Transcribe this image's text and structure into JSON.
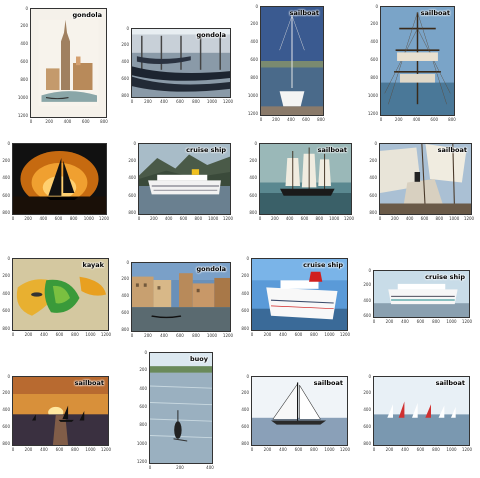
{
  "panels": [
    {
      "label": "gondola",
      "scene": "watercolor",
      "yticks": [
        "0",
        "200",
        "400",
        "600",
        "800",
        "1000",
        "1200"
      ],
      "xticks": [
        "0",
        "200",
        "400",
        "600",
        "800"
      ]
    },
    {
      "label": "gondola",
      "scene": "gondolas",
      "yticks": [
        "0",
        "200",
        "400",
        "600",
        "800"
      ],
      "xticks": [
        "0",
        "200",
        "400",
        "600",
        "800",
        "1000",
        "1200"
      ]
    },
    {
      "label": "sailboat",
      "scene": "sailboat-dock",
      "yticks": [
        "0",
        "200",
        "400",
        "600",
        "800",
        "1000",
        "1200"
      ],
      "xticks": [
        "0",
        "200",
        "400",
        "600",
        "800"
      ]
    },
    {
      "label": "sailboat",
      "scene": "tallship-mast",
      "yticks": [
        "0",
        "200",
        "400",
        "600",
        "800",
        "1000",
        "1200"
      ],
      "xticks": [
        "0",
        "200",
        "400",
        "600",
        "800"
      ]
    },
    {
      "label": "",
      "scene": "sunset-sail",
      "yticks": [
        "0",
        "200",
        "400",
        "600",
        "800"
      ],
      "xticks": [
        "0",
        "200",
        "400",
        "600",
        "800",
        "1000",
        "1200"
      ]
    },
    {
      "label": "cruise ship",
      "scene": "cruise-fjord",
      "yticks": [
        "0",
        "200",
        "400",
        "600",
        "800"
      ],
      "xticks": [
        "0",
        "200",
        "400",
        "600",
        "800",
        "1000",
        "1200"
      ]
    },
    {
      "label": "sailboat",
      "scene": "tallship-sea",
      "yticks": [
        "0",
        "200",
        "400",
        "600",
        "800"
      ],
      "xticks": [
        "0",
        "200",
        "400",
        "600",
        "800",
        "1000",
        "1200"
      ]
    },
    {
      "label": "sailboat",
      "scene": "sails-closeup",
      "yticks": [
        "0",
        "200",
        "400",
        "600",
        "800"
      ],
      "xticks": [
        "0",
        "200",
        "400",
        "600",
        "800",
        "1000",
        "1200"
      ]
    },
    {
      "label": "kayak",
      "scene": "kayaks",
      "yticks": [
        "0",
        "200",
        "400",
        "600",
        "800"
      ],
      "xticks": [
        "0",
        "200",
        "400",
        "600",
        "800",
        "1000",
        "1200"
      ]
    },
    {
      "label": "gondola",
      "scene": "canal",
      "yticks": [
        "0",
        "200",
        "400",
        "600",
        "800"
      ],
      "xticks": [
        "0",
        "200",
        "400",
        "600",
        "800",
        "1000",
        "1200"
      ]
    },
    {
      "label": "cruise ship",
      "scene": "cruise-port",
      "yticks": [
        "0",
        "200",
        "400",
        "600",
        "800"
      ],
      "xticks": [
        "0",
        "200",
        "400",
        "600",
        "800",
        "1000",
        "1200"
      ]
    },
    {
      "label": "cruise ship",
      "scene": "cruise-wide",
      "yticks": [
        "0",
        "200",
        "400",
        "600"
      ],
      "xticks": [
        "0",
        "200",
        "400",
        "600",
        "800",
        "1000",
        "1200"
      ]
    },
    {
      "label": "sailboat",
      "scene": "sunset-boats",
      "yticks": [
        "0",
        "200",
        "400",
        "600",
        "800"
      ],
      "xticks": [
        "0",
        "200",
        "400",
        "600",
        "800",
        "1000",
        "1200"
      ]
    },
    {
      "label": "buoy",
      "scene": "buoy",
      "yticks": [
        "0",
        "200",
        "400",
        "600",
        "800",
        "1000",
        "1200"
      ],
      "xticks": [
        "0",
        "200",
        "400"
      ]
    },
    {
      "label": "sailboat",
      "scene": "sail-mono",
      "yticks": [
        "0",
        "200",
        "400",
        "600",
        "800"
      ],
      "xticks": [
        "0",
        "200",
        "400",
        "600",
        "800",
        "1000",
        "1200"
      ]
    },
    {
      "label": "sailboat",
      "scene": "regatta",
      "yticks": [
        "0",
        "200",
        "400",
        "600",
        "800"
      ],
      "xticks": [
        "0",
        "200",
        "400",
        "600",
        "800",
        "1000",
        "1200"
      ]
    }
  ]
}
